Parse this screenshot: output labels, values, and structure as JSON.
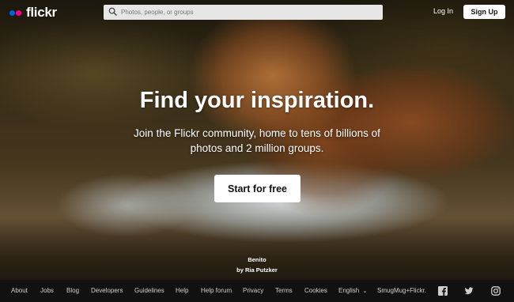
{
  "header": {
    "logo_text": "flickr",
    "search_placeholder": "Photos, people, or groups",
    "login_label": "Log In",
    "signup_label": "Sign Up"
  },
  "brand": {
    "blue_dot": "#0063dc",
    "pink_dot": "#ff0084"
  },
  "hero": {
    "title": "Find your inspiration.",
    "subtitle": "Join the Flickr community, home to tens of billions of photos and 2 million groups.",
    "cta_label": "Start for free",
    "photo_title": "Benito",
    "photo_credit": "by Ria Putzker"
  },
  "footer": {
    "links": [
      "About",
      "Jobs",
      "Blog",
      "Developers",
      "Guidelines",
      "Help",
      "Help forum",
      "Privacy",
      "Terms",
      "Cookies",
      "English",
      "SmugMug+Flickr."
    ],
    "social_icons": [
      "facebook-icon",
      "twitter-icon",
      "instagram-icon"
    ]
  }
}
